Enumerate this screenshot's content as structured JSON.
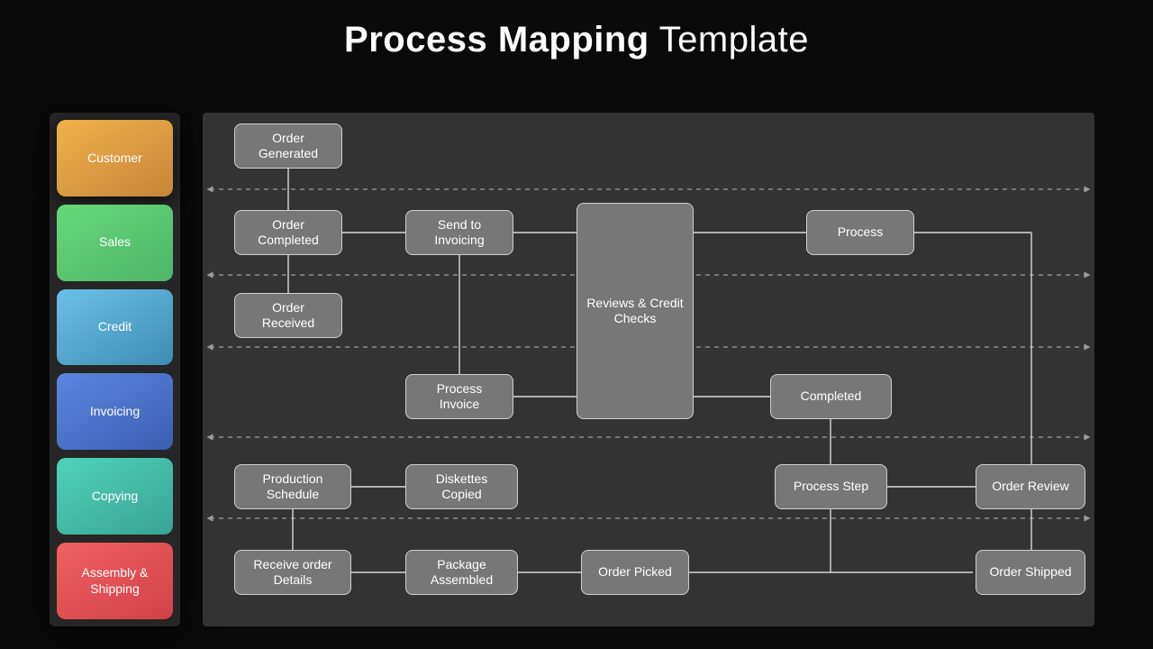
{
  "title": {
    "bold": "Process Mapping",
    "light": " Template"
  },
  "lanes": [
    {
      "label": "Customer"
    },
    {
      "label": "Sales"
    },
    {
      "label": "Credit"
    },
    {
      "label": "Invoicing"
    },
    {
      "label": "Copying"
    },
    {
      "label": "Assembly & Shipping"
    }
  ],
  "nodes": {
    "order_generated": "Order Generated",
    "order_completed": "Order Completed",
    "send_to_invoicing": "Send to Invoicing",
    "reviews_credit": "Reviews & Credit Checks",
    "process": "Process",
    "order_received": "Order Received",
    "process_invoice": "Process Invoice",
    "completed": "Completed",
    "production_schedule": "Production Schedule",
    "diskettes_copied": "Diskettes Copied",
    "process_step": "Process Step",
    "order_review": "Order Review",
    "receive_details": "Receive order Details",
    "package_assembled": "Package Assembled",
    "order_picked": "Order Picked",
    "order_shipped": "Order Shipped"
  }
}
